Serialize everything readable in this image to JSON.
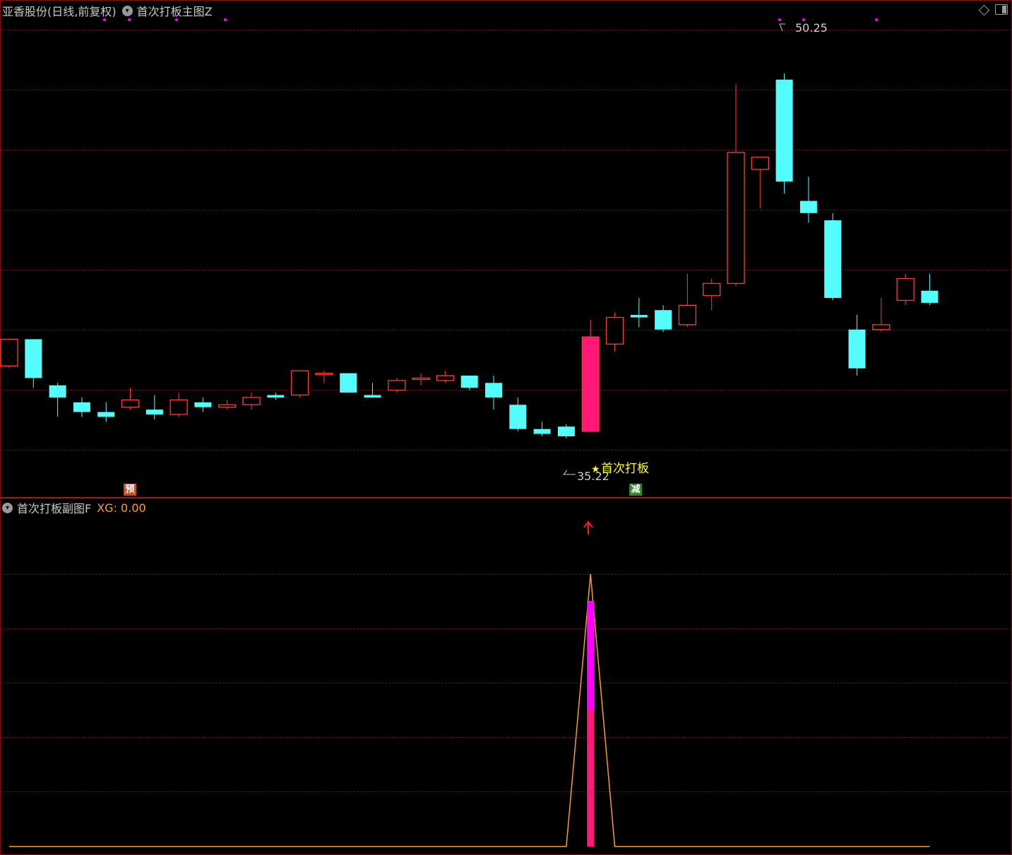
{
  "main_pane": {
    "stock_title": "亚香股份(日线,前复权)",
    "indicator_name": "首次打板主图Z"
  },
  "sub_pane": {
    "indicator_name": "首次打板副图F",
    "xg_label": "XG: 0.00"
  },
  "icons": [
    "chevron-down-icon",
    "diamond-icon",
    "panel-toggle-icon",
    "up-arrow-icon",
    "star-icon"
  ],
  "colors": {
    "background": "#000000",
    "up_candle": "#ff3b3b",
    "down_candle": "#54fcfc",
    "limit_up_candle": "#ff1877",
    "grid": "#5c1212",
    "signal_text": "#ffff00",
    "xg_line": "#ff9933",
    "spike_magenta": "#ff00ff"
  },
  "markers": {
    "high_label": "50.25",
    "low_label": "35.22",
    "signal_text": "首次打板",
    "badge_pre": "预",
    "badge_reduce": "减"
  },
  "chart_data": [
    {
      "type": "candlestick",
      "title": "亚香股份(日线,前复权)",
      "price_range": [
        33.0,
        52.0
      ],
      "candles": [
        {
          "o": 38.2,
          "h": 38.4,
          "c": 39.3,
          "l": 38.1
        },
        {
          "o": 39.3,
          "h": 39.3,
          "c": 37.7,
          "l": 37.3
        },
        {
          "o": 37.4,
          "h": 37.5,
          "c": 36.9,
          "l": 36.1
        },
        {
          "o": 36.7,
          "h": 36.9,
          "c": 36.3,
          "l": 36.1
        },
        {
          "o": 36.3,
          "h": 36.7,
          "c": 36.1,
          "l": 35.9
        },
        {
          "o": 36.5,
          "h": 37.3,
          "c": 36.8,
          "l": 36.4
        },
        {
          "o": 36.4,
          "h": 37.0,
          "c": 36.2,
          "l": 36.0
        },
        {
          "o": 36.2,
          "h": 37.1,
          "c": 36.8,
          "l": 36.1
        },
        {
          "o": 36.7,
          "h": 36.9,
          "c": 36.5,
          "l": 36.3
        },
        {
          "o": 36.5,
          "h": 36.8,
          "c": 36.6,
          "l": 36.4
        },
        {
          "o": 36.6,
          "h": 37.1,
          "c": 36.9,
          "l": 36.4
        },
        {
          "o": 37.0,
          "h": 37.1,
          "c": 36.9,
          "l": 36.8
        },
        {
          "o": 37.0,
          "h": 38.0,
          "c": 38.0,
          "l": 36.9
        },
        {
          "o": 37.9,
          "h": 38.0,
          "c": 37.9,
          "l": 37.5
        },
        {
          "o": 37.9,
          "h": 37.9,
          "c": 37.1,
          "l": 37.1
        },
        {
          "o": 37.0,
          "h": 37.5,
          "c": 36.9,
          "l": 36.9
        },
        {
          "o": 37.2,
          "h": 37.7,
          "c": 37.6,
          "l": 37.1
        },
        {
          "o": 37.7,
          "h": 37.9,
          "c": 37.7,
          "l": 37.4
        },
        {
          "o": 37.6,
          "h": 38.0,
          "c": 37.8,
          "l": 37.5
        },
        {
          "o": 37.8,
          "h": 37.8,
          "c": 37.3,
          "l": 37.2
        },
        {
          "o": 37.5,
          "h": 37.8,
          "c": 36.9,
          "l": 36.4
        },
        {
          "o": 36.6,
          "h": 36.9,
          "c": 35.6,
          "l": 35.5
        },
        {
          "o": 35.6,
          "h": 35.9,
          "c": 35.4,
          "l": 35.3
        },
        {
          "o": 35.7,
          "h": 35.8,
          "c": 35.3,
          "l": 35.22
        },
        {
          "o": 35.5,
          "h": 40.1,
          "c": 39.4,
          "l": 35.5
        },
        {
          "o": 39.1,
          "h": 40.4,
          "c": 40.2,
          "l": 38.8
        },
        {
          "o": 40.3,
          "h": 41.0,
          "c": 40.2,
          "l": 39.8
        },
        {
          "o": 40.5,
          "h": 40.7,
          "c": 39.7,
          "l": 39.6
        },
        {
          "o": 39.9,
          "h": 42.0,
          "c": 40.7,
          "l": 39.8
        },
        {
          "o": 41.1,
          "h": 41.8,
          "c": 41.6,
          "l": 40.5
        },
        {
          "o": 41.6,
          "h": 49.8,
          "c": 47.0,
          "l": 41.5
        },
        {
          "o": 46.3,
          "h": 46.8,
          "c": 46.8,
          "l": 44.7
        },
        {
          "o": 50.0,
          "h": 50.25,
          "c": 45.8,
          "l": 45.3
        },
        {
          "o": 45.0,
          "h": 46.0,
          "c": 44.5,
          "l": 44.1
        },
        {
          "o": 44.2,
          "h": 44.5,
          "c": 41.0,
          "l": 40.9
        },
        {
          "o": 39.7,
          "h": 40.3,
          "c": 38.1,
          "l": 37.8
        },
        {
          "o": 39.7,
          "h": 41.0,
          "c": 39.9,
          "l": 39.6
        },
        {
          "o": 40.9,
          "h": 42.0,
          "c": 41.8,
          "l": 40.7
        },
        {
          "o": 41.3,
          "h": 42.0,
          "c": 40.8,
          "l": 40.7
        }
      ],
      "highlight_index": 24,
      "high_value": 50.25,
      "low_value": 35.22
    },
    {
      "type": "line",
      "title": "首次打板副图F",
      "series": [
        {
          "name": "XG",
          "values": [
            0,
            0,
            0,
            0,
            0,
            0,
            0,
            0,
            0,
            0,
            0,
            0,
            0,
            0,
            0,
            0,
            0,
            0,
            0,
            0,
            0,
            0,
            0,
            0,
            1,
            0,
            0,
            0,
            0,
            0,
            0,
            0,
            0,
            0,
            0,
            0,
            0,
            0,
            0
          ]
        }
      ],
      "spike_index": 24
    }
  ]
}
